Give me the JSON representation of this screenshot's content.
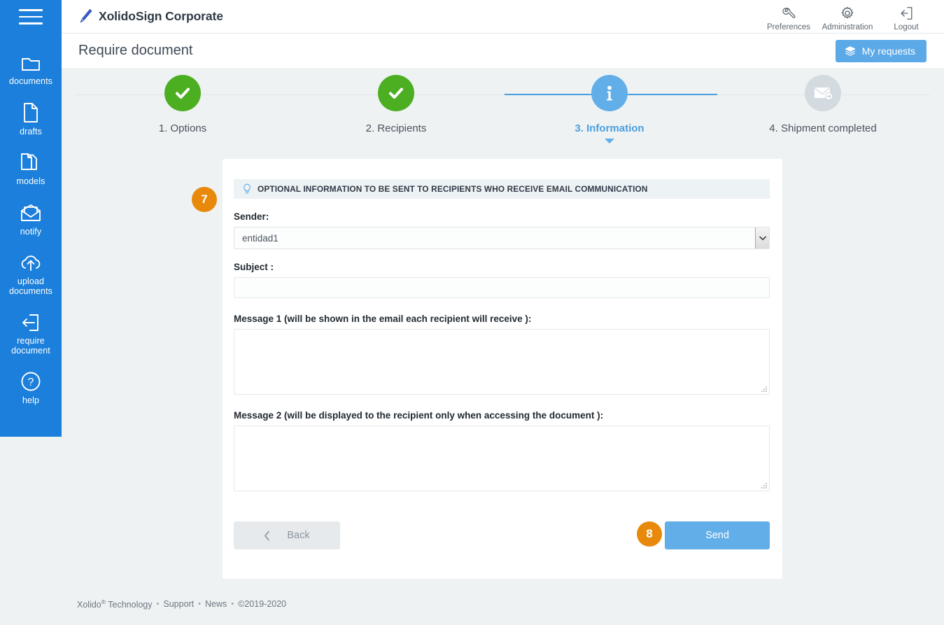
{
  "colors": {
    "sidebar_blue": "#1B7FDB",
    "accent_blue": "#62AEE8",
    "badge_orange": "#E8890C",
    "step_green": "#4CAF22",
    "page_bg": "#eef2f3"
  },
  "sidebar": {
    "menu_icon": "hamburger-icon",
    "items": [
      {
        "icon": "folder-icon",
        "label": "documents"
      },
      {
        "icon": "document-icon",
        "label": "drafts"
      },
      {
        "icon": "documents-stack-icon",
        "label": "models"
      },
      {
        "icon": "envelope-open-icon",
        "label": "notify"
      },
      {
        "icon": "cloud-upload-icon",
        "label": "upload\ndocuments"
      },
      {
        "icon": "door-exit-icon",
        "label": "require\ndocument"
      },
      {
        "icon": "question-circle-icon",
        "label": "help"
      }
    ]
  },
  "topbar": {
    "logo_icon": "pen-icon",
    "brand": "XolidoSign Corporate",
    "actions": [
      {
        "icon": "wrench-icon",
        "label": "Preferences"
      },
      {
        "icon": "gear-icon",
        "label": "Administration"
      },
      {
        "icon": "logout-icon",
        "label": "Logout"
      }
    ]
  },
  "page": {
    "title": "Require document",
    "my_requests_label": "My requests",
    "my_requests_icon": "layers-icon"
  },
  "stepper": {
    "steps": [
      {
        "label": "1. Options",
        "state": "done",
        "icon": "check-icon"
      },
      {
        "label": "2. Recipients",
        "state": "done",
        "icon": "check-icon"
      },
      {
        "label": "3. Information",
        "state": "current",
        "icon": "info-icon"
      },
      {
        "label": "4. Shipment completed",
        "state": "pending",
        "icon": "envelope-send-icon"
      }
    ]
  },
  "card": {
    "badges": {
      "seven": "7",
      "eight": "8"
    },
    "panel_header": {
      "icon": "lightbulb-icon",
      "text": "OPTIONAL INFORMATION TO BE SENT TO RECIPIENTS WHO RECEIVE EMAIL COMMUNICATION"
    },
    "fields": {
      "sender_label": "Sender:",
      "sender_value": "entidad1",
      "sender_options": [
        "entidad1"
      ],
      "subject_label": "Subject :",
      "subject_value": "",
      "subject_placeholder": "",
      "message1_label": "Message 1 (will be shown in the email each recipient will receive ):",
      "message1_value": "",
      "message2_label": "Message 2 (will be displayed to the recipient only when accessing the document ):",
      "message2_value": ""
    },
    "buttons": {
      "back_label": "Back",
      "back_icon": "chevron-left-icon",
      "send_label": "Send"
    }
  },
  "footer": {
    "brand": "Xolido",
    "brand_sup": "®",
    "brand_tail": " Technology",
    "support": "Support",
    "news": "News",
    "copyright": "©2019-2020",
    "separator": "•"
  }
}
